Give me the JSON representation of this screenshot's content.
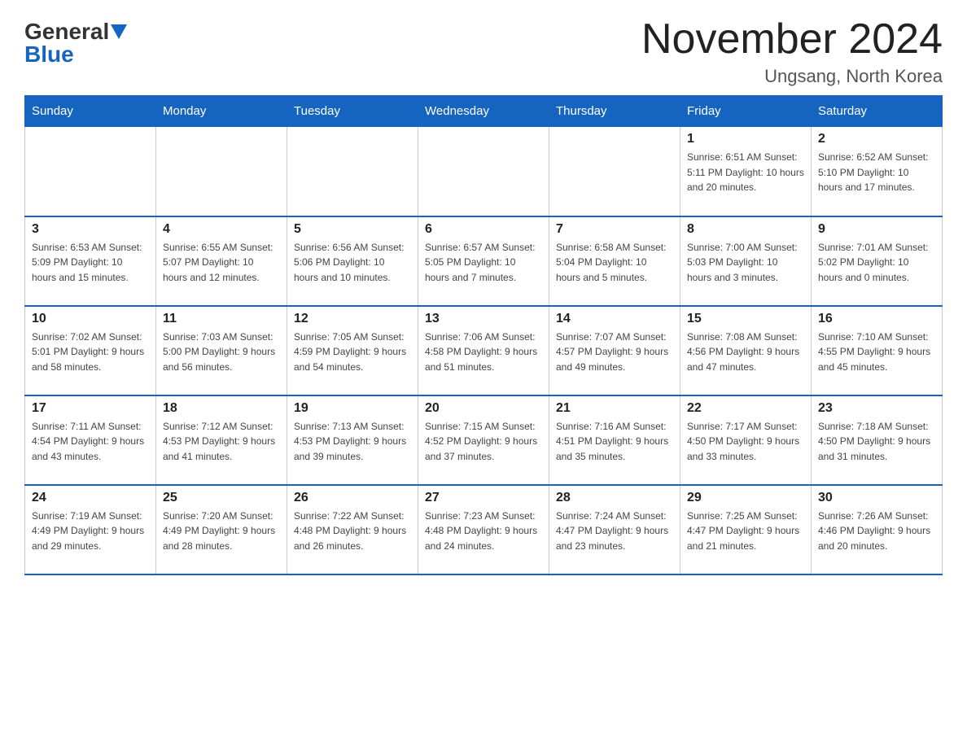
{
  "logo": {
    "general": "General",
    "blue": "Blue"
  },
  "title": "November 2024",
  "location": "Ungsang, North Korea",
  "days_of_week": [
    "Sunday",
    "Monday",
    "Tuesday",
    "Wednesday",
    "Thursday",
    "Friday",
    "Saturday"
  ],
  "weeks": [
    [
      {
        "day": "",
        "info": ""
      },
      {
        "day": "",
        "info": ""
      },
      {
        "day": "",
        "info": ""
      },
      {
        "day": "",
        "info": ""
      },
      {
        "day": "",
        "info": ""
      },
      {
        "day": "1",
        "info": "Sunrise: 6:51 AM\nSunset: 5:11 PM\nDaylight: 10 hours\nand 20 minutes."
      },
      {
        "day": "2",
        "info": "Sunrise: 6:52 AM\nSunset: 5:10 PM\nDaylight: 10 hours\nand 17 minutes."
      }
    ],
    [
      {
        "day": "3",
        "info": "Sunrise: 6:53 AM\nSunset: 5:09 PM\nDaylight: 10 hours\nand 15 minutes."
      },
      {
        "day": "4",
        "info": "Sunrise: 6:55 AM\nSunset: 5:07 PM\nDaylight: 10 hours\nand 12 minutes."
      },
      {
        "day": "5",
        "info": "Sunrise: 6:56 AM\nSunset: 5:06 PM\nDaylight: 10 hours\nand 10 minutes."
      },
      {
        "day": "6",
        "info": "Sunrise: 6:57 AM\nSunset: 5:05 PM\nDaylight: 10 hours\nand 7 minutes."
      },
      {
        "day": "7",
        "info": "Sunrise: 6:58 AM\nSunset: 5:04 PM\nDaylight: 10 hours\nand 5 minutes."
      },
      {
        "day": "8",
        "info": "Sunrise: 7:00 AM\nSunset: 5:03 PM\nDaylight: 10 hours\nand 3 minutes."
      },
      {
        "day": "9",
        "info": "Sunrise: 7:01 AM\nSunset: 5:02 PM\nDaylight: 10 hours\nand 0 minutes."
      }
    ],
    [
      {
        "day": "10",
        "info": "Sunrise: 7:02 AM\nSunset: 5:01 PM\nDaylight: 9 hours\nand 58 minutes."
      },
      {
        "day": "11",
        "info": "Sunrise: 7:03 AM\nSunset: 5:00 PM\nDaylight: 9 hours\nand 56 minutes."
      },
      {
        "day": "12",
        "info": "Sunrise: 7:05 AM\nSunset: 4:59 PM\nDaylight: 9 hours\nand 54 minutes."
      },
      {
        "day": "13",
        "info": "Sunrise: 7:06 AM\nSunset: 4:58 PM\nDaylight: 9 hours\nand 51 minutes."
      },
      {
        "day": "14",
        "info": "Sunrise: 7:07 AM\nSunset: 4:57 PM\nDaylight: 9 hours\nand 49 minutes."
      },
      {
        "day": "15",
        "info": "Sunrise: 7:08 AM\nSunset: 4:56 PM\nDaylight: 9 hours\nand 47 minutes."
      },
      {
        "day": "16",
        "info": "Sunrise: 7:10 AM\nSunset: 4:55 PM\nDaylight: 9 hours\nand 45 minutes."
      }
    ],
    [
      {
        "day": "17",
        "info": "Sunrise: 7:11 AM\nSunset: 4:54 PM\nDaylight: 9 hours\nand 43 minutes."
      },
      {
        "day": "18",
        "info": "Sunrise: 7:12 AM\nSunset: 4:53 PM\nDaylight: 9 hours\nand 41 minutes."
      },
      {
        "day": "19",
        "info": "Sunrise: 7:13 AM\nSunset: 4:53 PM\nDaylight: 9 hours\nand 39 minutes."
      },
      {
        "day": "20",
        "info": "Sunrise: 7:15 AM\nSunset: 4:52 PM\nDaylight: 9 hours\nand 37 minutes."
      },
      {
        "day": "21",
        "info": "Sunrise: 7:16 AM\nSunset: 4:51 PM\nDaylight: 9 hours\nand 35 minutes."
      },
      {
        "day": "22",
        "info": "Sunrise: 7:17 AM\nSunset: 4:50 PM\nDaylight: 9 hours\nand 33 minutes."
      },
      {
        "day": "23",
        "info": "Sunrise: 7:18 AM\nSunset: 4:50 PM\nDaylight: 9 hours\nand 31 minutes."
      }
    ],
    [
      {
        "day": "24",
        "info": "Sunrise: 7:19 AM\nSunset: 4:49 PM\nDaylight: 9 hours\nand 29 minutes."
      },
      {
        "day": "25",
        "info": "Sunrise: 7:20 AM\nSunset: 4:49 PM\nDaylight: 9 hours\nand 28 minutes."
      },
      {
        "day": "26",
        "info": "Sunrise: 7:22 AM\nSunset: 4:48 PM\nDaylight: 9 hours\nand 26 minutes."
      },
      {
        "day": "27",
        "info": "Sunrise: 7:23 AM\nSunset: 4:48 PM\nDaylight: 9 hours\nand 24 minutes."
      },
      {
        "day": "28",
        "info": "Sunrise: 7:24 AM\nSunset: 4:47 PM\nDaylight: 9 hours\nand 23 minutes."
      },
      {
        "day": "29",
        "info": "Sunrise: 7:25 AM\nSunset: 4:47 PM\nDaylight: 9 hours\nand 21 minutes."
      },
      {
        "day": "30",
        "info": "Sunrise: 7:26 AM\nSunset: 4:46 PM\nDaylight: 9 hours\nand 20 minutes."
      }
    ]
  ]
}
